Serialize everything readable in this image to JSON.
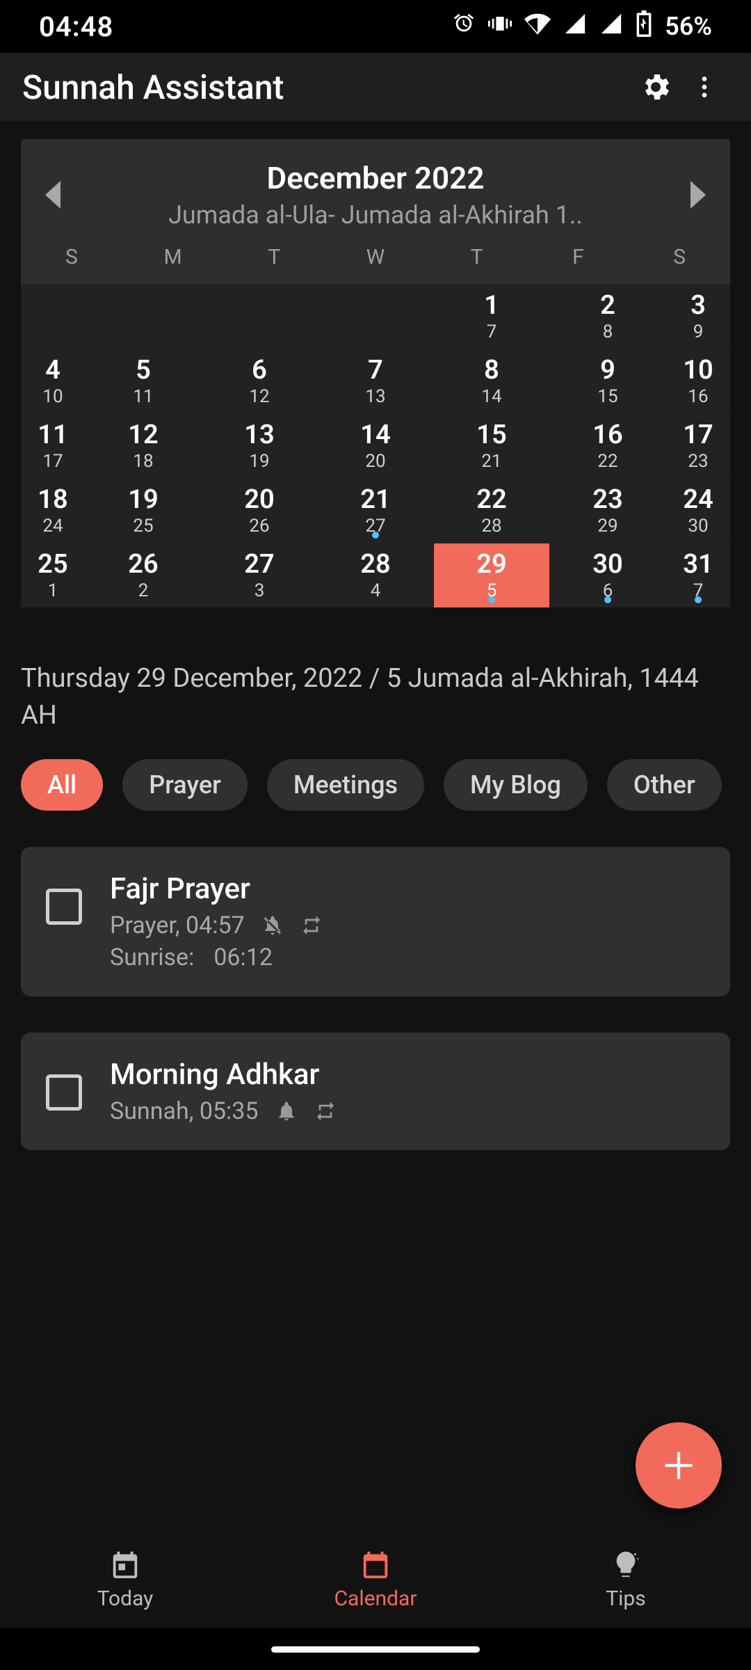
{
  "status": {
    "time": "04:48",
    "battery": "56%"
  },
  "header": {
    "title": "Sunnah Assistant"
  },
  "calendar": {
    "month_label": "December 2022",
    "hijri_label": "Jumada al-Ula- Jumada al-Akhirah 1..",
    "dow": [
      "S",
      "M",
      "T",
      "W",
      "T",
      "F",
      "S"
    ],
    "weeks": [
      [
        null,
        null,
        null,
        null,
        {
          "g": "1",
          "h": "7"
        },
        {
          "g": "2",
          "h": "8"
        },
        {
          "g": "3",
          "h": "9"
        }
      ],
      [
        {
          "g": "4",
          "h": "10"
        },
        {
          "g": "5",
          "h": "11"
        },
        {
          "g": "6",
          "h": "12"
        },
        {
          "g": "7",
          "h": "13"
        },
        {
          "g": "8",
          "h": "14"
        },
        {
          "g": "9",
          "h": "15"
        },
        {
          "g": "10",
          "h": "16"
        }
      ],
      [
        {
          "g": "11",
          "h": "17"
        },
        {
          "g": "12",
          "h": "18"
        },
        {
          "g": "13",
          "h": "19"
        },
        {
          "g": "14",
          "h": "20"
        },
        {
          "g": "15",
          "h": "21"
        },
        {
          "g": "16",
          "h": "22"
        },
        {
          "g": "17",
          "h": "23"
        }
      ],
      [
        {
          "g": "18",
          "h": "24"
        },
        {
          "g": "19",
          "h": "25"
        },
        {
          "g": "20",
          "h": "26"
        },
        {
          "g": "21",
          "h": "27",
          "dot": true
        },
        {
          "g": "22",
          "h": "28"
        },
        {
          "g": "23",
          "h": "29"
        },
        {
          "g": "24",
          "h": "30"
        }
      ],
      [
        {
          "g": "25",
          "h": "1"
        },
        {
          "g": "26",
          "h": "2"
        },
        {
          "g": "27",
          "h": "3"
        },
        {
          "g": "28",
          "h": "4"
        },
        {
          "g": "29",
          "h": "5",
          "selected": true,
          "dot": true
        },
        {
          "g": "30",
          "h": "6",
          "dot": true
        },
        {
          "g": "31",
          "h": "7",
          "dot": true
        }
      ]
    ]
  },
  "date_line": "Thursday 29 December, 2022 / 5 Jumada al-Akhirah, 1444 AH",
  "filters": [
    {
      "label": "All",
      "active": true
    },
    {
      "label": "Prayer"
    },
    {
      "label": "Meetings"
    },
    {
      "label": "My Blog"
    },
    {
      "label": "Other"
    }
  ],
  "tasks": [
    {
      "title": "Fajr Prayer",
      "category": "Prayer,",
      "time": "04:57",
      "bell": "off",
      "repeat": true,
      "extra_label": "Sunrise:",
      "extra_value": "06:12"
    },
    {
      "title": "Morning Adhkar",
      "category": "Sunnah,",
      "time": "05:35",
      "bell": "on",
      "repeat": true
    }
  ],
  "nav": {
    "today": "Today",
    "calendar": "Calendar",
    "tips": "Tips"
  }
}
